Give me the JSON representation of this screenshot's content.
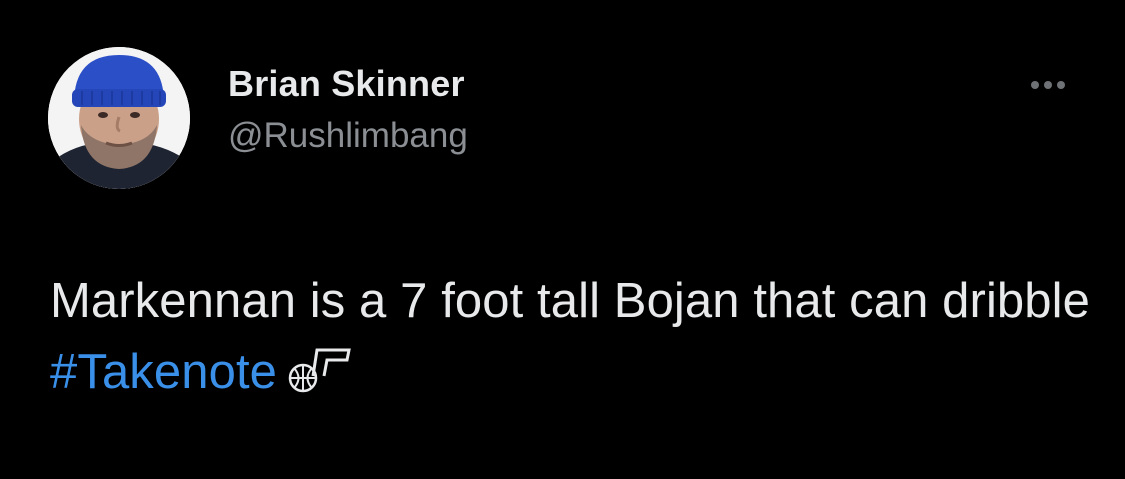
{
  "author": {
    "display_name": "Brian Skinner",
    "handle": "@Rushlimbang",
    "avatar_icon": "profile-photo-man-blue-beanie"
  },
  "more_icon": "ellipsis-icon",
  "tweet": {
    "text_before": "Markennan is a 7 foot tall Bojan that can dribble ",
    "hashtag": "#Takenote",
    "emoji_icon": "utah-jazz-note-logo"
  },
  "colors": {
    "background": "#000000",
    "text_primary": "#e7e9ea",
    "text_secondary": "#8b8f94",
    "link": "#3a8fe8"
  }
}
